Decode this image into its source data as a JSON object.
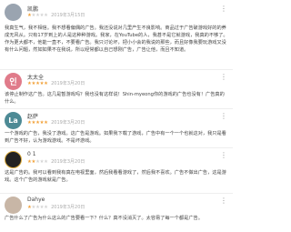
{
  "comments": [
    {
      "name": "凯鹏",
      "avatar_text": "",
      "avatar_color": "#9aa4b0",
      "stars": 1,
      "date": "2019年3月15日",
      "body": "我真生气，我不相信。我不想看偏偶的广告。我还没说对几里产生不良影响。商品过于广告破游戏好的的养成无风从。只有17岁到上的人是这种种游戏。我家，在YouTube的人，我甚不是它就游戏，我真的不够了。作为更大都不，他能一直不，不要看广告。我只讨论坏，把小小会的我说的那些，而且好像我要玩游戏又没有什么问题，然如如果不在我说，所以经常都以自己想刚广告，广告让他，而且不知道。"
    },
    {
      "name": "太太全",
      "avatar_text": "인",
      "avatar_color": "#e07b8a",
      "stars": 5,
      "date": "2019年3月20日",
      "body": "该停止制作这广告。这几是暂游戏吗？我也没有这样说！Shin-myeong你的游戏的广告也没有！广告真的什么。"
    },
    {
      "name": "赵萨",
      "avatar_text": "La",
      "avatar_color": "#4d8a95",
      "stars": 5,
      "date": "2019年3月20日",
      "body": "一个游戏的广告，我没了游戏。这广告是游戏。如果我下载了游戏，广告中有一个一个也就这对，我只是看到广告不好，认为游戏游戏。不是坏游戏。"
    },
    {
      "name": "0 1",
      "avatar_text": "",
      "avatar_color": "#222222",
      "stars": 2,
      "date": "2019年3月20日",
      "body": "这是广告的。我可以看到我有真在电视里面，然后我看看游戏了，然后我不喜欢。广告不做出广告，这是游戏。这个广告的游戏就是广告。"
    },
    {
      "name": "Dahye",
      "avatar_text": "",
      "avatar_color": "#c8b6a6",
      "stars": 1,
      "date": "2019年3月20日",
      "body": "广告什么了广告为什么这么的广告要看一下？什么？真不没消灭了。太容易了每一个都是广告。"
    }
  ],
  "more_icon": "more-vertical-icon"
}
